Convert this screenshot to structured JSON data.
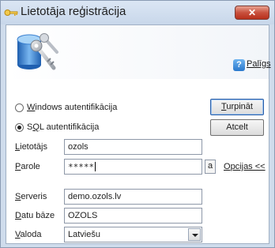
{
  "window": {
    "title": "Lietotāja reģistrācija",
    "close_label": "✕"
  },
  "help": {
    "icon_glyph": "?",
    "label": "Palīgs"
  },
  "auth": {
    "windows": {
      "label_u": "W",
      "label_rest": "indows autentifikācija",
      "checked": false
    },
    "sql": {
      "label_pre": "S",
      "label_u": "Q",
      "label_rest": "L autentifikācija",
      "checked": true
    }
  },
  "buttons": {
    "continue": {
      "u": "T",
      "rest": "urpināt"
    },
    "cancel": "Atcelt",
    "show_password": "a",
    "options": {
      "u": "O",
      "rest": "pcijas <<"
    }
  },
  "fields": {
    "user": {
      "label_u": "L",
      "label_rest": "ietotājs",
      "value": "ozols"
    },
    "password": {
      "label_u": "P",
      "label_rest": "arole",
      "value": "*****"
    },
    "server": {
      "label_u": "S",
      "label_rest": "erveris",
      "value": "demo.ozols.lv"
    },
    "database": {
      "label_u": "D",
      "label_rest": "atu bāze",
      "value": "OZOLS"
    },
    "language": {
      "label_u": "V",
      "label_rest": "aloda",
      "value": "Latviešu"
    }
  },
  "colors": {
    "titlebar": "#c8d7ea",
    "frame": "#cfdcec",
    "close": "#c8513e",
    "accent": "#2b5fa8"
  }
}
